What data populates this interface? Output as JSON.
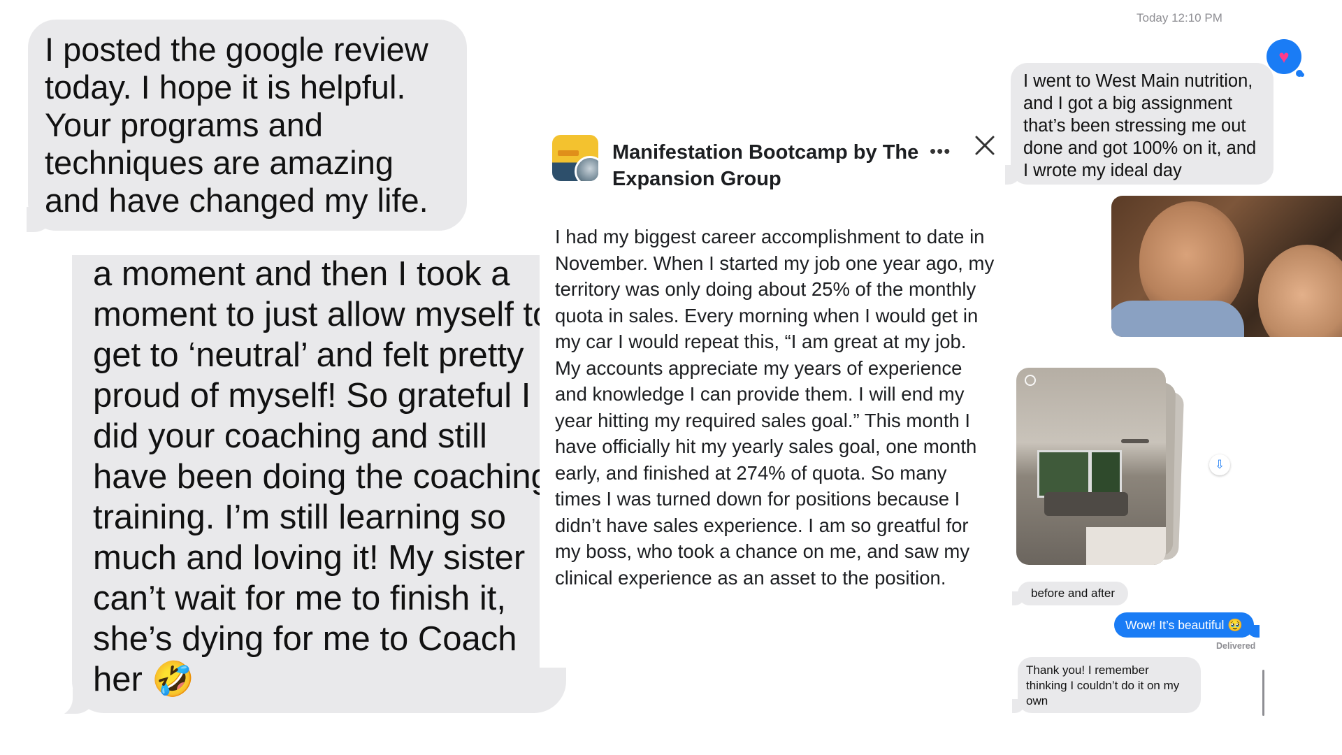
{
  "left_messages": [
    {
      "text": "I posted the google review today. I hope it is helpful. Your programs and techniques are amazing and have changed my life."
    },
    {
      "text": "a moment and then I took a moment to just allow myself to get to ‘neutral’ and felt pretty proud of myself! So grateful I did your coaching and still have been doing the coaching training. I’m still learning so much and loving it! My sister can’t wait for me to finish it, she’s dying for me to Coach her 🤣"
    }
  ],
  "post": {
    "page_name": "Manifestation Bootcamp by The Expansion Group",
    "more_glyph": "•••",
    "body": "I had my biggest career accomplishment to date in November. When I started my job one year ago, my territory was only doing about 25% of the monthly quota in sales. Every morning when I would get in my car I would repeat this, “I am great at my job. My accounts appreciate my years of experience and knowledge I can provide them. I will end my year hitting my required sales goal.”  This month I have officially hit my yearly sales goal, one month early, and finished at 274% of quota. So many times I was turned down for positions because I didn’t have sales experience. I am so greatful for my boss, who took a chance on me, and saw my clinical experience as an asset to the position."
  },
  "thread": {
    "timestamp": "Today 12:10 PM",
    "message_1": "I went to West Main nutrition, and I got a big assignment that’s been stressing me out done and got 100% on it, and I wrote my ideal day",
    "reaction": "♥",
    "caption": "before and after",
    "sent_message": "Wow! It’s beautiful 🥹",
    "delivered_label": "Delivered",
    "message_4": "Thank you! I remember thinking I couldn’t do it on my own"
  },
  "colors": {
    "bubble_gray": "#e9e9eb",
    "imessage_blue": "#1a7cf5",
    "heart_pink": "#ff3b8a"
  },
  "icons": [
    "close-icon",
    "more-icon",
    "heart-reaction-icon",
    "save-icon",
    "live-photo-icon"
  ]
}
